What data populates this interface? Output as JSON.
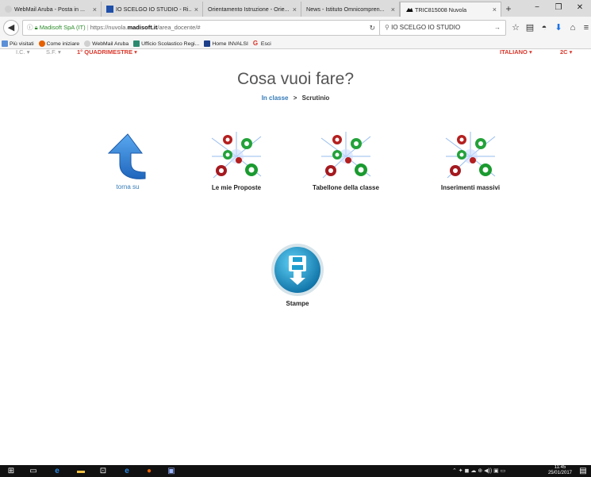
{
  "browser": {
    "tabs": [
      {
        "title": "WebMail Aruba - Posta in ..."
      },
      {
        "title": "IO SCELGO IO STUDIO - Ri..."
      },
      {
        "title": "Orientamento Istruzione - Orie..."
      },
      {
        "title": "News - Istituto Omnicompren..."
      },
      {
        "title": "TRIC815008 Nuvola"
      }
    ],
    "new_tab": "+",
    "close_glyph": "×",
    "window_controls": {
      "minimize": "−",
      "maximize": "❐",
      "close": "✕"
    },
    "url": {
      "site": "Madisoft SpA (IT)",
      "prefix": "https://nuvola.",
      "domain": "madisoft.it",
      "path": "/area_docente/#"
    },
    "search_text": "IO SCELGO IO STUDIO",
    "bookmarks": [
      {
        "label": "Più visitati"
      },
      {
        "label": "Come iniziare"
      },
      {
        "label": "WebMail Aruba"
      },
      {
        "label": "Ufficio Scolastico Regi..."
      },
      {
        "label": "Home INVALSI"
      },
      {
        "label": "Esci"
      }
    ]
  },
  "app_menu": {
    "left": [
      "I.C. ▾",
      "S.F. ▾"
    ],
    "period": "1° QUADRIMESTRE ▾",
    "subject": "ITALIANO ▾",
    "class": "2C ▾"
  },
  "page": {
    "title": "Cosa vuoi fare?",
    "breadcrumb_link": "In classe",
    "breadcrumb_sep": ">",
    "breadcrumb_current": "Scrutinio"
  },
  "tiles": {
    "back": "torna su",
    "proposals": "Le mie Proposte",
    "class_board": "Tabellone della classe",
    "bulk_insert": "Inserimenti massivi",
    "print": "Stampe"
  },
  "taskbar": {
    "time": "11:45",
    "date": "25/01/2017"
  },
  "colors": {
    "link": "#337ab7",
    "menu_red": "#d9362a",
    "arrow_blue": "#2f7fd1",
    "print_teal": "#1e9fd0"
  }
}
